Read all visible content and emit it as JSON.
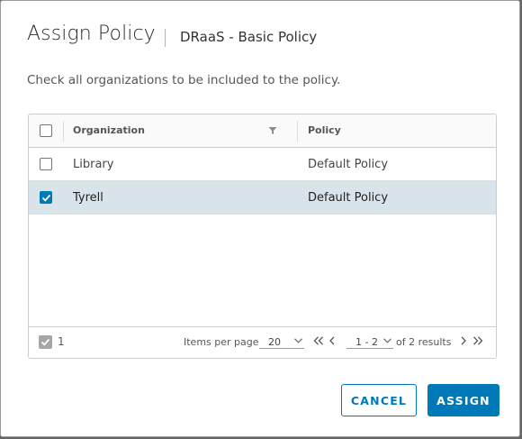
{
  "dialog": {
    "title": "Assign Policy",
    "subtitle": "DRaaS - Basic Policy",
    "instructions": "Check all organizations to be included to the policy."
  },
  "grid": {
    "columns": [
      {
        "label": "Organization",
        "filterable": true
      },
      {
        "label": "Policy"
      }
    ],
    "rows": [
      {
        "organization": "Library",
        "policy": "Default Policy",
        "checked": false
      },
      {
        "organization": "Tyrell",
        "policy": "Default Policy",
        "checked": true
      }
    ],
    "footer": {
      "selected_count": "1",
      "items_per_page_label": "Items per page",
      "items_per_page": "20",
      "page_range": "1 - 2",
      "results_text": "of 2 results"
    }
  },
  "buttons": {
    "cancel": "CANCEL",
    "assign": "ASSIGN"
  },
  "colors": {
    "accent": "#0079b8",
    "selected_row": "#d9e4ea"
  }
}
